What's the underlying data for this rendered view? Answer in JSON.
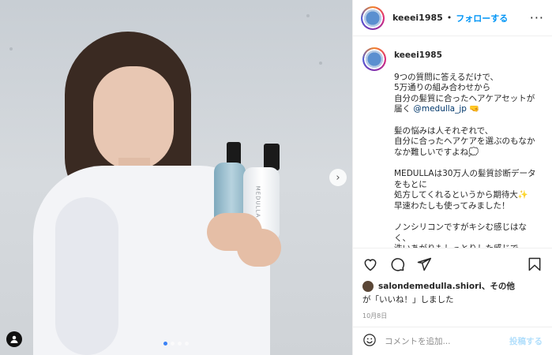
{
  "post": {
    "username": "keeei1985",
    "separator": "•",
    "follow_label": "フォローする",
    "more_label": "···"
  },
  "caption": {
    "username": "keeei1985",
    "para1": "9つの質問に答えるだけで、\n5万通りの組み合わせから\n自分の髪質に合ったヘアケアセットが届く",
    "mention": "@medulla_jp",
    "para2": "髪の悩みは人それぞれで、\n自分に合ったヘアケアを選ぶのもなかなか難しいですよね💭",
    "para3": "MEDULLAは30万人の髪質診断データをもとに\n処方してくれるというから期待大✨\n早速わたしも使ってみました！",
    "para4": "ノンシリコンですがキシむ感じはなく、\n洗いあがりもしっとりした感じで..."
  },
  "likes": {
    "liker": "salondemedulla.shiori",
    "and_others": "、その他",
    "suffix": "が「いいね！」しました"
  },
  "date": "10月8日",
  "comment": {
    "placeholder": "コメントを追加...",
    "post_label": "投稿する"
  },
  "media": {
    "next_symbol": "›",
    "bottle_label": "MEDULLA",
    "carousel_count": 4,
    "carousel_active": 0
  },
  "colors": {
    "accent": "#0095f6",
    "mention": "#00376b",
    "post_disabled": "#b2dffc"
  }
}
